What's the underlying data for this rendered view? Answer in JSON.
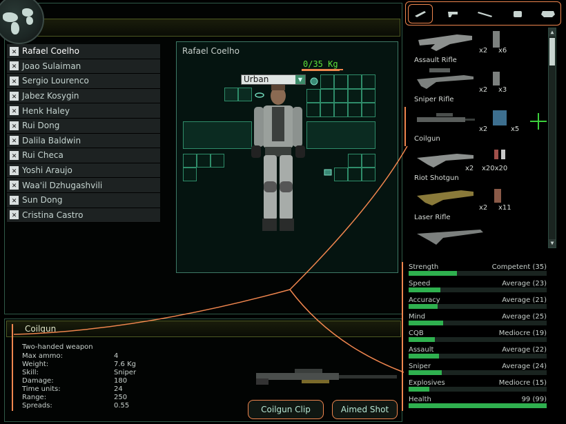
{
  "roster": [
    {
      "name": "Rafael Coelho",
      "selected": true
    },
    {
      "name": "Joao Sulaiman"
    },
    {
      "name": "Sergio Lourenco"
    },
    {
      "name": "Jabez Kosygin"
    },
    {
      "name": "Henk Haley"
    },
    {
      "name": "Rui Dong"
    },
    {
      "name": "Dalila Baldwin"
    },
    {
      "name": "Rui Checa"
    },
    {
      "name": "Yoshi Araujo"
    },
    {
      "name": "Waa'il Dzhugashvili"
    },
    {
      "name": "Sun Dong"
    },
    {
      "name": "Cristina Castro"
    }
  ],
  "checkbox_glyph": "✕",
  "soldier": {
    "name": "Rafael Coelho",
    "weight": "0/35 Kg",
    "armour": "Urban",
    "armour_arrow": "▼"
  },
  "weapon": {
    "name": "Coilgun",
    "description": "Two-handed weapon",
    "stats": [
      {
        "label": "Max ammo:",
        "value": "4"
      },
      {
        "label": "Weight:",
        "value": "7.6 Kg"
      },
      {
        "label": "Skill:",
        "value": "Sniper"
      },
      {
        "label": "Damage:",
        "value": "180"
      },
      {
        "label": "Time units:",
        "value": "24"
      },
      {
        "label": "Range:",
        "value": "250"
      },
      {
        "label": "Spreads:",
        "value": "0.55"
      }
    ],
    "ammo_button": "Coilgun Clip",
    "fire_button": "Aimed Shot"
  },
  "tabs": [
    {
      "icon": "rifle-icon",
      "active": true
    },
    {
      "icon": "pistol-icon"
    },
    {
      "icon": "launcher-icon"
    },
    {
      "icon": "grenade-icon"
    },
    {
      "icon": "armour-icon"
    }
  ],
  "inventory": [
    {
      "name": "Assault Rifle",
      "weapon_count": "x2",
      "ammo_count": "x6"
    },
    {
      "name": "Sniper Rifle",
      "weapon_count": "x2",
      "ammo_count": "x3"
    },
    {
      "name": "Coilgun",
      "weapon_count": "x2",
      "ammo_count": "x5",
      "highlight": true
    },
    {
      "name": "Riot Shotgun",
      "weapon_count": "x2",
      "ammo_count": "x20x20"
    },
    {
      "name": "Laser Rifle",
      "weapon_count": "x2",
      "ammo_count": "x11"
    },
    {
      "name": "",
      "weapon_count": "",
      "ammo_count": ""
    }
  ],
  "attributes": [
    {
      "name": "Strength",
      "value": "Competent (35)",
      "level": 0.35
    },
    {
      "name": "Speed",
      "value": "Average (23)",
      "level": 0.23
    },
    {
      "name": "Accuracy",
      "value": "Average (21)",
      "level": 0.21
    },
    {
      "name": "Mind",
      "value": "Average (25)",
      "level": 0.25
    },
    {
      "name": "CQB",
      "value": "Mediocre (19)",
      "level": 0.19
    },
    {
      "name": "Assault",
      "value": "Average (22)",
      "level": 0.22
    },
    {
      "name": "Sniper",
      "value": "Average (24)",
      "level": 0.24
    },
    {
      "name": "Explosives",
      "value": "Mediocre (15)",
      "level": 0.15
    },
    {
      "name": "Health",
      "value": "99 (99)",
      "level": 1.0
    }
  ],
  "colors": {
    "accent_orange": "#f0864e",
    "bar_green": "#2fb04f",
    "weight_green": "#5fe13a",
    "slot_teal": "#2f8d6a"
  }
}
